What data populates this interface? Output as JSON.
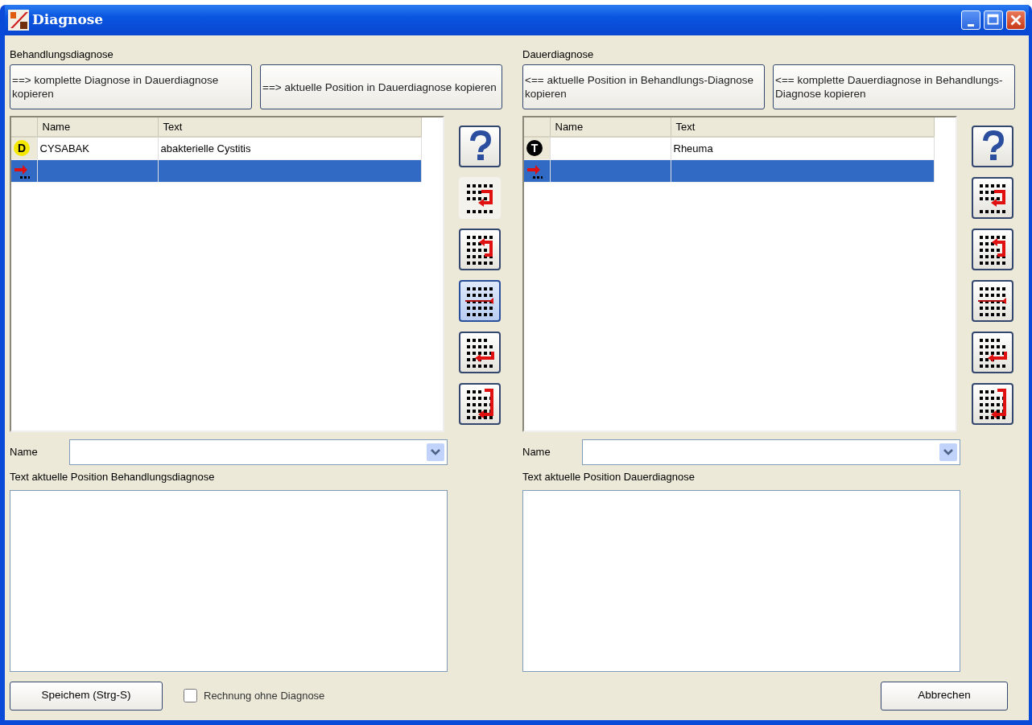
{
  "window": {
    "title": "Diagnose"
  },
  "panels": [
    {
      "heading": "Behandlungsdiagnose",
      "copy_buttons": [
        "==> komplette Diagnose in Dauerdiagnose kopieren",
        "==> aktuelle Position in Dauerdiagnose kopieren"
      ],
      "table": {
        "columns": [
          "Name",
          "Text"
        ],
        "rows": [
          {
            "kind": "entry",
            "badge": "D",
            "color": "#f5e800",
            "name": "CYSABAK",
            "text": "abakterielle Cystitis",
            "selected": false
          },
          {
            "kind": "new",
            "selected": true
          }
        ]
      },
      "tool_buttons": [
        {
          "kind": "help",
          "flat": false,
          "hot": false
        },
        {
          "kind": "insert-below",
          "flat": true,
          "hot": false
        },
        {
          "kind": "insert-above",
          "flat": false,
          "hot": false
        },
        {
          "kind": "split",
          "flat": false,
          "hot": true
        },
        {
          "kind": "move",
          "flat": false,
          "hot": false
        },
        {
          "kind": "append",
          "flat": false,
          "hot": false
        }
      ],
      "name_field": {
        "label": "Name"
      },
      "text_field": {
        "label": "Text aktuelle Position Behandlungsdiagnose"
      }
    },
    {
      "heading": "Dauerdiagnose",
      "copy_buttons": [
        "<== aktuelle Position in Behandlungs-Diagnose kopieren",
        "<== komplette Dauerdiagnose in Behandlungs-Diagnose kopieren"
      ],
      "table": {
        "columns": [
          "Name",
          "Text"
        ],
        "rows": [
          {
            "kind": "entry",
            "badge": "T",
            "color": "#000000",
            "name": "",
            "text": "Rheuma",
            "selected": false
          },
          {
            "kind": "new",
            "selected": true
          }
        ]
      },
      "tool_buttons": [
        {
          "kind": "help",
          "flat": false,
          "hot": false
        },
        {
          "kind": "insert-below",
          "flat": false,
          "hot": false
        },
        {
          "kind": "insert-above",
          "flat": false,
          "hot": false
        },
        {
          "kind": "split",
          "flat": false,
          "hot": false
        },
        {
          "kind": "move",
          "flat": false,
          "hot": false
        },
        {
          "kind": "append",
          "flat": false,
          "hot": false
        }
      ],
      "name_field": {
        "label": "Name"
      },
      "text_field": {
        "label": "Text aktuelle Position Dauerdiagnose"
      }
    }
  ],
  "footer": {
    "save_button": "Speichem (Strg-S)",
    "checkbox": {
      "label": "Rechnung ohne Diagnose",
      "checked": false
    },
    "cancel_button": "Abbrechen"
  }
}
